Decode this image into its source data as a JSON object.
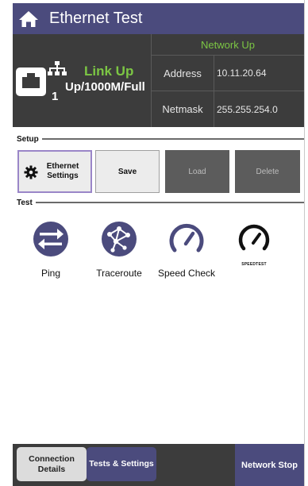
{
  "header": {
    "title": "Ethernet Test"
  },
  "status": {
    "port_number": "1",
    "link_state": "Link Up",
    "link_speed": "Up/1000M/Full",
    "network_state": "Network Up",
    "address_label": "Address",
    "address_value": "10.11.20.64",
    "netmask_label": "Netmask",
    "netmask_value": "255.255.254.0"
  },
  "setup": {
    "section_title": "Setup",
    "ethernet_settings_label": "Ethernet Settings",
    "save_label": "Save",
    "load_label": "Load",
    "delete_label": "Delete"
  },
  "test": {
    "section_title": "Test",
    "items": [
      {
        "label": "Ping",
        "icon": "ping-icon"
      },
      {
        "label": "Traceroute",
        "icon": "traceroute-icon"
      },
      {
        "label": "Speed Check",
        "icon": "speed-check-icon"
      },
      {
        "label": "SPEEDTEST",
        "icon": "speedtest-icon"
      }
    ]
  },
  "bottom": {
    "tabs": [
      {
        "label": "Connection Details"
      },
      {
        "label": "Tests & Settings"
      }
    ],
    "network_stop_label": "Network Stop"
  },
  "colors": {
    "accent": "#4b4b7d",
    "status_green": "#7cc644",
    "panel_dark": "#3c3c3c",
    "selected_outline": "#9a86c8"
  }
}
